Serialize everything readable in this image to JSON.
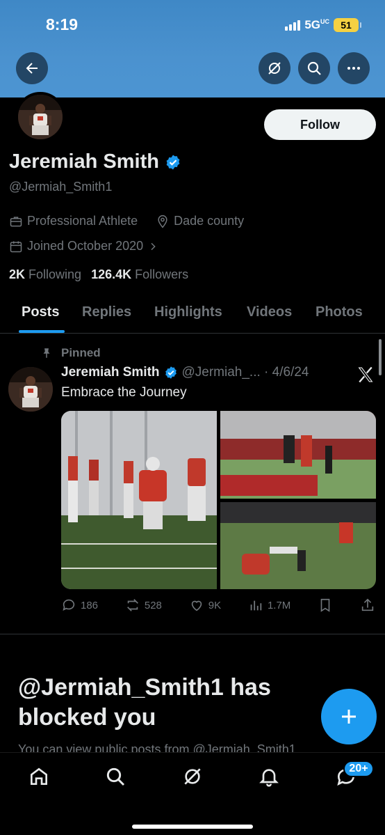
{
  "status_bar": {
    "time": "8:19",
    "network": "5G",
    "battery": "51"
  },
  "header": {
    "back_icon": "arrow-left-icon",
    "grok_icon": "grok-icon",
    "search_icon": "search-icon",
    "more_icon": "more-icon"
  },
  "profile": {
    "follow_label": "Follow",
    "name": "Jeremiah Smith",
    "handle": "@Jermiah_Smith1",
    "category": "Professional Athlete",
    "location": "Dade county",
    "joined": "Joined October 2020",
    "following_count": "2K",
    "following_label": "Following",
    "followers_count": "126.4K",
    "followers_label": "Followers"
  },
  "tabs": [
    "Posts",
    "Replies",
    "Highlights",
    "Videos",
    "Photos"
  ],
  "post": {
    "pinned_label": "Pinned",
    "author": "Jeremiah Smith",
    "handle_date": "@Jermiah_... · 4/6/24",
    "text": "Embrace the Journey",
    "replies": "186",
    "reposts": "528",
    "likes": "9K",
    "views": "1.7M"
  },
  "blocked": {
    "title": "@Jermiah_Smith1 has blocked you",
    "subtitle": "You can view public posts from @Jermiah_Smith1"
  },
  "bottom_nav": {
    "notifications_badge": "20+"
  },
  "colors": {
    "accent": "#1d9bf0",
    "banner": "#4b92cf",
    "muted": "#71767b"
  }
}
